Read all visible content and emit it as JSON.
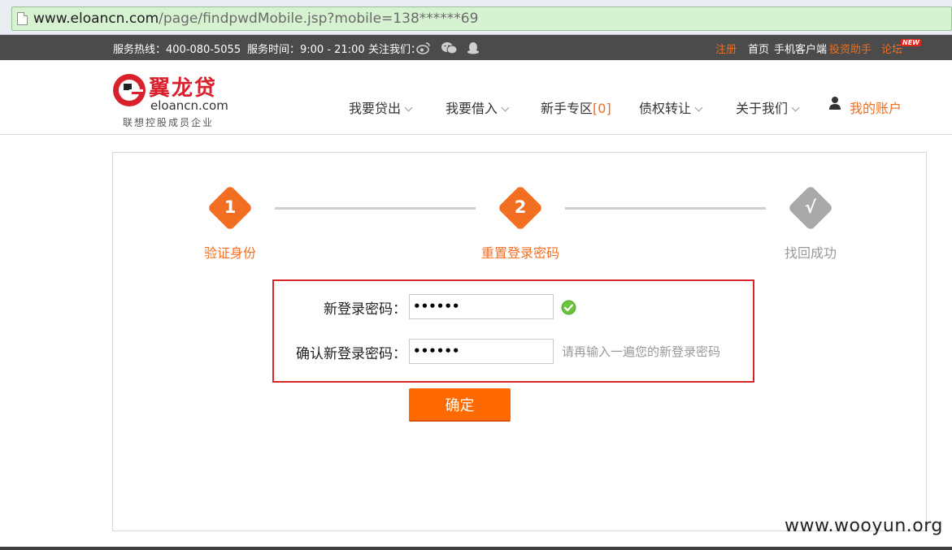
{
  "browser": {
    "url_host": "www.eloancn.com",
    "url_path": "/page/findpwdMobile.jsp?mobile=138******69"
  },
  "topbar": {
    "hotline": "服务热线：400-080-5055",
    "hours": "服务时间：9:00 - 21:00",
    "follow": "关注我们：",
    "social_icons": [
      "weibo-icon",
      "wechat-icon",
      "qq-icon"
    ],
    "register": "注册",
    "home": "首页",
    "mobile_client": "手机客户端",
    "invest_helper": "投资助手",
    "forum": "论坛",
    "new_badge": "NEW"
  },
  "logo": {
    "brand": "翼龙贷",
    "domain": "eloancn.com",
    "slogan": "联想控股成员企业"
  },
  "nav": {
    "lend": "我要贷出",
    "borrow": "我要借入",
    "newbie": "新手专区",
    "newbie_count": "[0]",
    "transfer": "债权转让",
    "about": "关于我们",
    "account": "我的账户"
  },
  "steps": [
    {
      "number": "1",
      "label": "验证身份",
      "state": "done"
    },
    {
      "number": "2",
      "label": "重置登录密码",
      "state": "active"
    },
    {
      "number": "√",
      "label": "找回成功",
      "state": "pending"
    }
  ],
  "form": {
    "new_password_label": "新登录密码：",
    "new_password_value": "••••••",
    "confirm_password_label": "确认新登录密码：",
    "confirm_password_value": "••••••",
    "confirm_hint": "请再输入一遍您的新登录密码",
    "submit_label": "确定"
  },
  "watermark": "www.wooyun.org",
  "colors": {
    "accent_orange": "#f26f21",
    "button_orange": "#fe6a00",
    "pending_gray": "#a9a9a9",
    "highlight_red": "#d7262b",
    "brand_red": "#d8212c",
    "topbar_bg": "#4b4b4b"
  }
}
